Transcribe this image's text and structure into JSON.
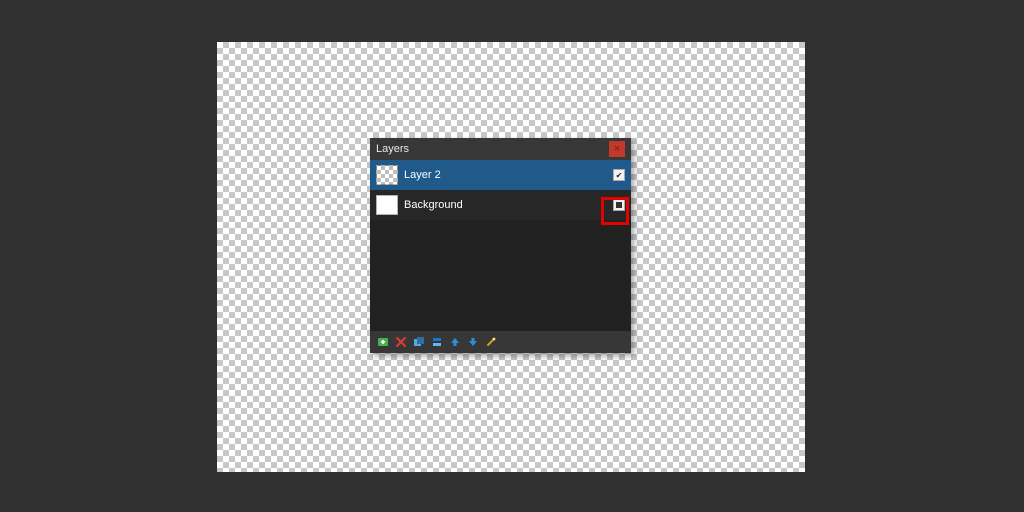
{
  "panel": {
    "title": "Layers",
    "layers": [
      {
        "name": "Layer 2",
        "thumb": "checker",
        "selected": true,
        "visibility": "checked"
      },
      {
        "name": "Background",
        "thumb": "white",
        "selected": false,
        "visibility": "filled"
      }
    ],
    "actions": {
      "add": "Add Layer",
      "delete": "Delete Layer",
      "duplicate": "Duplicate Layer",
      "merge": "Merge Down",
      "move_up": "Move Up",
      "move_down": "Move Down",
      "properties": "Properties"
    }
  },
  "colors": {
    "bg": "#303030",
    "panel_bg": "#212121",
    "header_bg": "#383838",
    "selected": "#1f5a8a",
    "close": "#c0392b",
    "highlight": "#e60000"
  }
}
